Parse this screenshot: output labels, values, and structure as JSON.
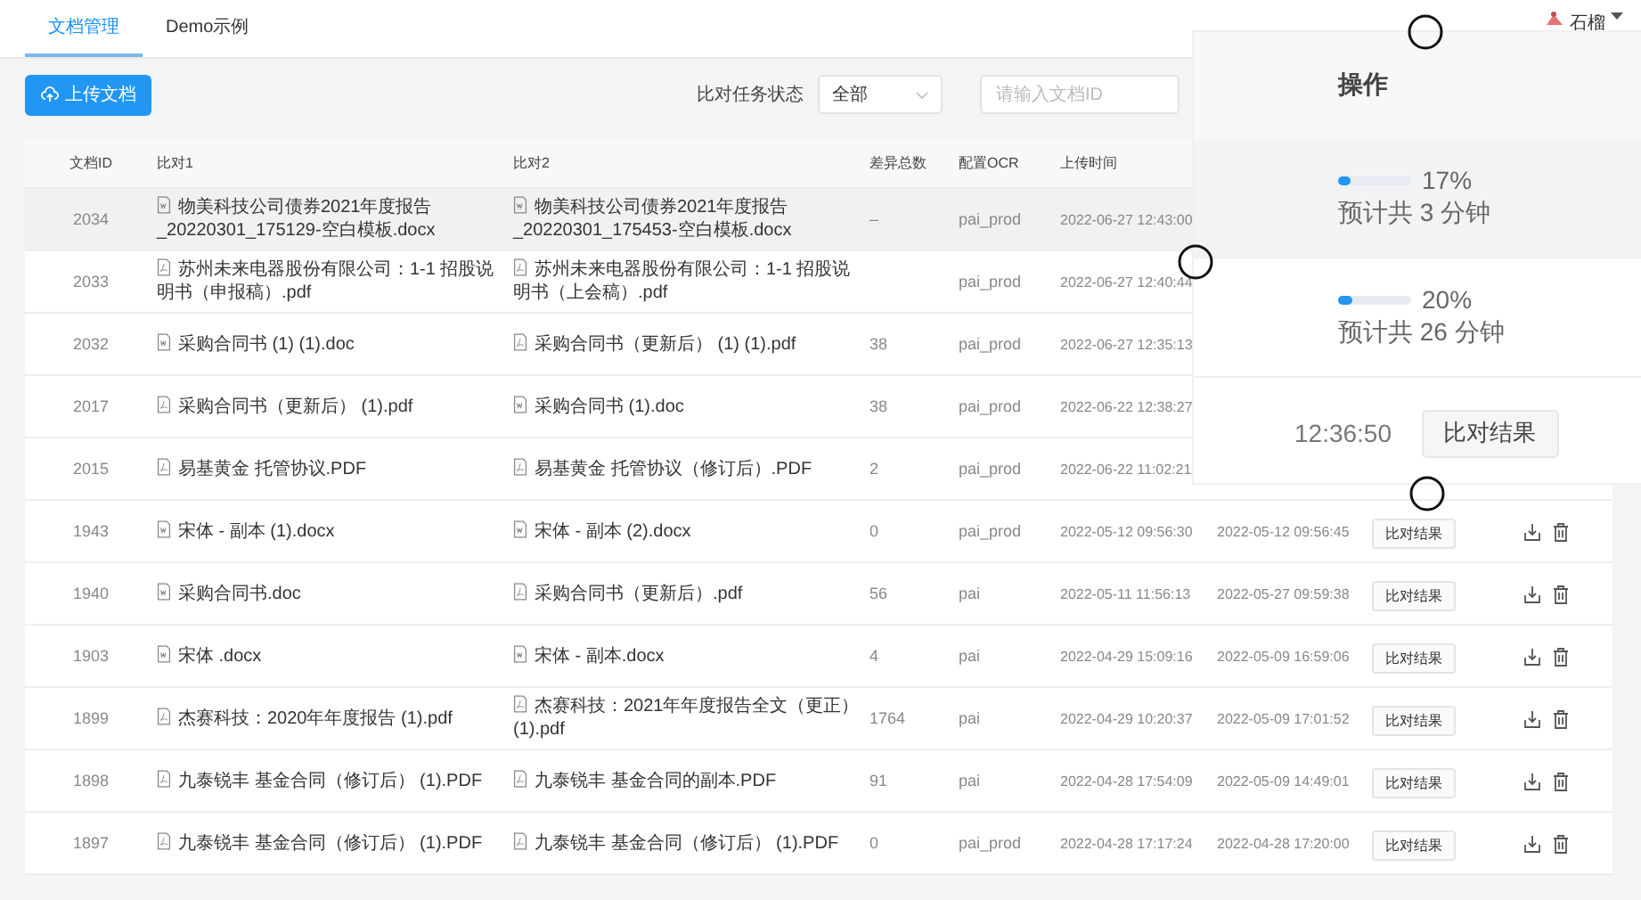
{
  "tabs": [
    {
      "label": "文档管理",
      "selected": true
    },
    {
      "label": "Demo示例",
      "selected": false
    }
  ],
  "user": {
    "name": "石榴"
  },
  "toolbar": {
    "upload_button": "上传文档",
    "status_label": "比对任务状态",
    "status_value": "全部",
    "search": {
      "placeholder": "请输入文档ID"
    }
  },
  "table": {
    "columns": [
      "文档ID",
      "比对1",
      "比对2",
      "差异总数",
      "配置OCR",
      "上传时间"
    ],
    "rows": [
      {
        "id": "2034",
        "file1": {
          "kind": "word",
          "name": "物美科技公司债券2021年度报告_20220301_175129-空白模板.docx"
        },
        "file2": {
          "kind": "word",
          "name": "物美科技公司债券2021年度报告_20220301_175453-空白模板.docx"
        },
        "diff": "–",
        "ocr": "pai_prod",
        "uploaded": "2022-06-27 12:43:00",
        "selected": true
      },
      {
        "id": "2033",
        "file1": {
          "kind": "pdf",
          "name": "苏州未来电器股份有限公司：1-1 招股说明书（申报稿）.pdf"
        },
        "file2": {
          "kind": "pdf",
          "name": "苏州未来电器股份有限公司：1-1 招股说明书（上会稿）.pdf"
        },
        "ocr": "pai_prod",
        "uploaded": "2022-06-27 12:40:44",
        "selected": false
      },
      {
        "id": "2032",
        "file1": {
          "kind": "word",
          "name": "采购合同书 (1) (1).doc"
        },
        "file2": {
          "kind": "pdf",
          "name": "采购合同书（更新后） (1) (1).pdf"
        },
        "diff": "38",
        "ocr": "pai_prod",
        "uploaded": "2022-06-27 12:35:13",
        "selected": false
      },
      {
        "id": "2017",
        "file1": {
          "kind": "pdf",
          "name": "采购合同书（更新后） (1).pdf"
        },
        "file2": {
          "kind": "word",
          "name": "采购合同书 (1).doc"
        },
        "diff": "38",
        "ocr": "pai_prod",
        "uploaded": "2022-06-22 12:38:27",
        "selected": false
      },
      {
        "id": "2015",
        "file1": {
          "kind": "pdf",
          "name": "易基黄金 托管协议.PDF"
        },
        "file2": {
          "kind": "pdf",
          "name": "易基黄金 托管协议（修订后）.PDF"
        },
        "diff": "2",
        "ocr": "pai_prod",
        "uploaded": "2022-06-22 11:02:21",
        "selected": false
      },
      {
        "id": "1943",
        "file1": {
          "kind": "word",
          "name": "宋体 - 副本 (1).docx"
        },
        "file2": {
          "kind": "word",
          "name": "宋体 - 副本 (2).docx"
        },
        "diff": "0",
        "ocr": "pai_prod",
        "uploaded": "2022-05-12 09:56:30",
        "updated": "2022-05-12 09:56:45",
        "result_button": "比对结果",
        "selected": false
      },
      {
        "id": "1940",
        "file1": {
          "kind": "word",
          "name": "采购合同书.doc"
        },
        "file2": {
          "kind": "pdf",
          "name": "采购合同书（更新后）.pdf"
        },
        "diff": "56",
        "ocr": "pai",
        "uploaded": "2022-05-11 11:56:13",
        "updated": "2022-05-27 09:59:38",
        "result_button": "比对结果",
        "selected": false
      },
      {
        "id": "1903",
        "file1": {
          "kind": "word",
          "name": "宋体 .docx"
        },
        "file2": {
          "kind": "word",
          "name": "宋体 - 副本.docx"
        },
        "diff": "4",
        "ocr": "pai",
        "uploaded": "2022-04-29 15:09:16",
        "updated": "2022-05-09 16:59:06",
        "result_button": "比对结果",
        "selected": false
      },
      {
        "id": "1899",
        "file1": {
          "kind": "pdf",
          "name": "杰赛科技：2020年年度报告 (1).pdf"
        },
        "file2": {
          "kind": "pdf",
          "name": "杰赛科技：2021年年度报告全文（更正）(1).pdf"
        },
        "diff": "1764",
        "ocr": "pai",
        "uploaded": "2022-04-29 10:20:37",
        "updated": "2022-05-09 17:01:52",
        "result_button": "比对结果",
        "selected": false
      },
      {
        "id": "1898",
        "file1": {
          "kind": "pdf",
          "name": "九泰锐丰 基金合同（修订后） (1).PDF"
        },
        "file2": {
          "kind": "pdf",
          "name": "九泰锐丰 基金合同的副本.PDF"
        },
        "diff": "91",
        "ocr": "pai",
        "uploaded": "2022-04-28 17:54:09",
        "updated": "2022-05-09 14:49:01",
        "result_button": "比对结果",
        "selected": false
      },
      {
        "id": "1897",
        "file1": {
          "kind": "pdf",
          "name": "九泰锐丰 基金合同（修订后） (1).PDF"
        },
        "file2": {
          "kind": "pdf",
          "name": "九泰锐丰 基金合同（修订后） (1).PDF"
        },
        "diff": "0",
        "ocr": "pai_prod",
        "uploaded": "2022-04-28 17:17:24",
        "updated": "2022-04-28 17:20:00",
        "result_button": "比对结果",
        "selected": false
      }
    ]
  },
  "magnifier": {
    "header": "操作",
    "rows": [
      {
        "kind": "progress",
        "level": 0.17,
        "percent": "17%",
        "estimate": "预计共 3 分钟",
        "selected": true
      },
      {
        "kind": "progress",
        "level": 0.2,
        "percent": "20%",
        "estimate": "预计共 26 分钟",
        "selected": false
      },
      {
        "kind": "result",
        "time": "12:36:50",
        "button": "比对结果",
        "selected": false
      }
    ]
  }
}
